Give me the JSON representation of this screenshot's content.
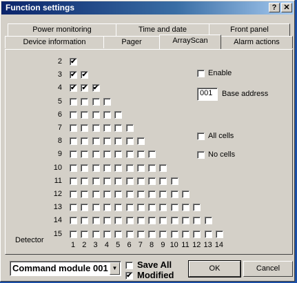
{
  "window": {
    "title": "Function settings",
    "help_label": "?",
    "close_label": "✕"
  },
  "tabs_row1": [
    {
      "label": "Power monitoring"
    },
    {
      "label": "Time and date"
    },
    {
      "label": "Front panel"
    }
  ],
  "tabs_row2": [
    {
      "label": "Device information"
    },
    {
      "label": "Pager"
    },
    {
      "label": "ArrayScan",
      "active": true
    },
    {
      "label": "Alarm actions"
    }
  ],
  "array_scan": {
    "rows": [
      {
        "label": "2",
        "checked": [
          true
        ]
      },
      {
        "label": "3",
        "checked": [
          true,
          true
        ]
      },
      {
        "label": "4",
        "checked": [
          true,
          true,
          true
        ]
      },
      {
        "label": "5",
        "checked": [
          false,
          false,
          false,
          false
        ]
      },
      {
        "label": "6",
        "checked": [
          false,
          false,
          false,
          false,
          false
        ]
      },
      {
        "label": "7",
        "checked": [
          false,
          false,
          false,
          false,
          false,
          false
        ]
      },
      {
        "label": "8",
        "checked": [
          false,
          false,
          false,
          false,
          false,
          false,
          false
        ]
      },
      {
        "label": "9",
        "checked": [
          false,
          false,
          false,
          false,
          false,
          false,
          false,
          false
        ]
      },
      {
        "label": "10",
        "checked": [
          false,
          false,
          false,
          false,
          false,
          false,
          false,
          false,
          false
        ]
      },
      {
        "label": "11",
        "checked": [
          false,
          false,
          false,
          false,
          false,
          false,
          false,
          false,
          false,
          false
        ]
      },
      {
        "label": "12",
        "checked": [
          false,
          false,
          false,
          false,
          false,
          false,
          false,
          false,
          false,
          false,
          false
        ]
      },
      {
        "label": "13",
        "checked": [
          false,
          false,
          false,
          false,
          false,
          false,
          false,
          false,
          false,
          false,
          false,
          false
        ]
      },
      {
        "label": "14",
        "checked": [
          false,
          false,
          false,
          false,
          false,
          false,
          false,
          false,
          false,
          false,
          false,
          false,
          false
        ]
      },
      {
        "label": "15",
        "checked": [
          false,
          false,
          false,
          false,
          false,
          false,
          false,
          false,
          false,
          false,
          false,
          false,
          false,
          false
        ]
      }
    ],
    "columns": [
      "1",
      "2",
      "3",
      "4",
      "5",
      "6",
      "7",
      "8",
      "9",
      "10",
      "11",
      "12",
      "13",
      "14"
    ],
    "detector_label": "Detector",
    "enable": {
      "label": "Enable",
      "checked": false
    },
    "base_address": {
      "value": "001",
      "label": "Base address"
    },
    "all_cells": {
      "label": "All cells",
      "checked": false
    },
    "no_cells": {
      "label": "No cells",
      "checked": false
    }
  },
  "footer": {
    "module_select": {
      "value": "Command module 001"
    },
    "save_all": {
      "label": "Save All",
      "checked": false
    },
    "modified": {
      "label": "Modified",
      "checked": true
    },
    "ok_label": "OK",
    "cancel_label": "Cancel"
  },
  "glyphs": {
    "check": "✔",
    "combo_arrow": "▼"
  }
}
